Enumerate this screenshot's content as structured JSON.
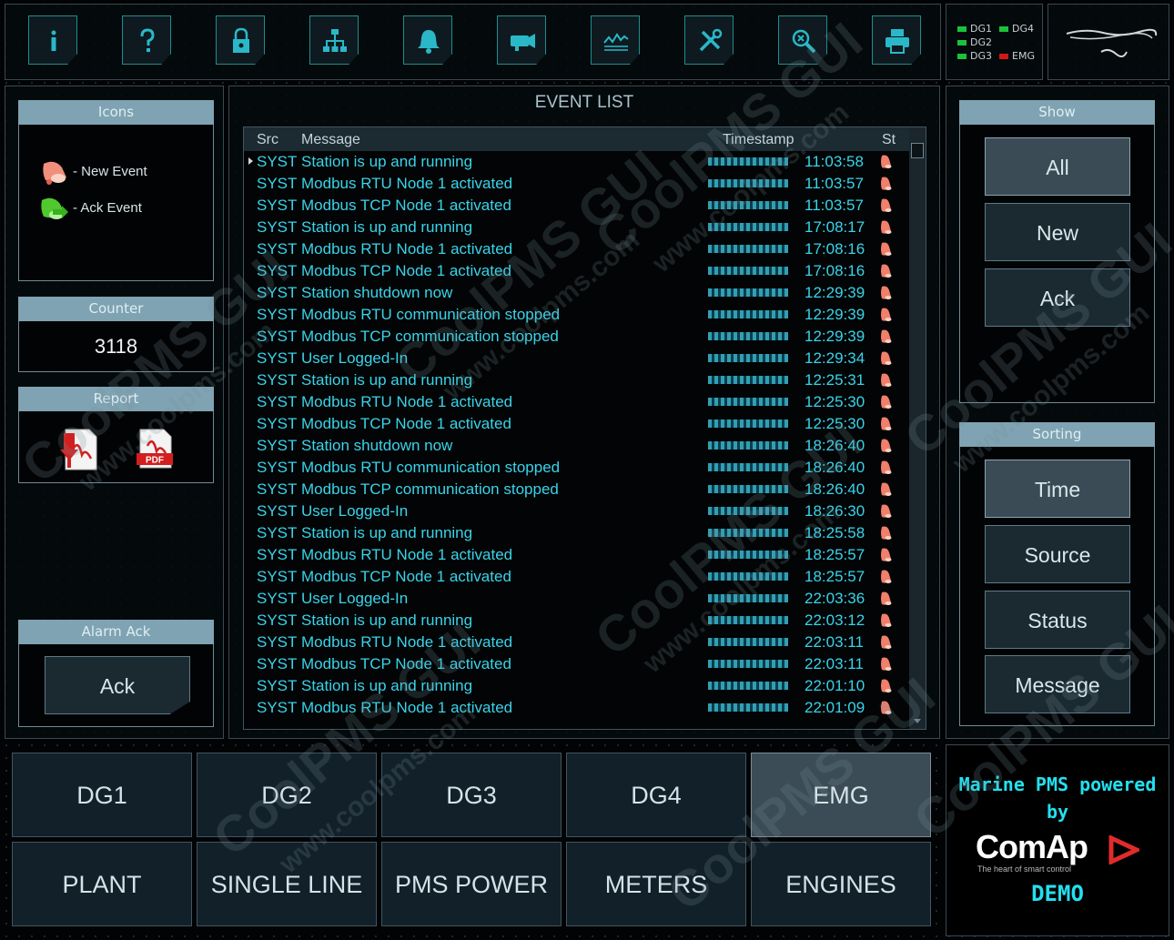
{
  "toolbar": {
    "icons": [
      "info-icon",
      "help-icon",
      "lock-icon",
      "network-icon",
      "bell-icon",
      "horn-icon",
      "trend-icon",
      "tools-icon",
      "search-icon",
      "printer-icon"
    ]
  },
  "indicators": [
    {
      "label": "DG1",
      "color": "#19c33a"
    },
    {
      "label": "DG4",
      "color": "#19c33a"
    },
    {
      "label": "DG2",
      "color": "#19c33a"
    },
    {
      "label": "DG3",
      "color": "#19c33a"
    },
    {
      "label": "EMG",
      "color": "#d01818"
    }
  ],
  "icons_panel": {
    "title": "Icons",
    "new_event": "- New Event",
    "ack_event": "- Ack Event"
  },
  "counter": {
    "title": "Counter",
    "value": "3118"
  },
  "report": {
    "title": "Report"
  },
  "alarm_ack": {
    "title": "Alarm Ack",
    "button": "Ack"
  },
  "event_list": {
    "title": "EVENT LIST",
    "columns": {
      "src": "Src",
      "message": "Message",
      "timestamp": "Timestamp",
      "status": "St"
    },
    "rows": [
      {
        "src": "SYST",
        "message": "Station is up and running",
        "time": "11:03:58"
      },
      {
        "src": "SYST",
        "message": "Modbus RTU Node 1 activated",
        "time": "11:03:57"
      },
      {
        "src": "SYST",
        "message": "Modbus TCP Node 1 activated",
        "time": "11:03:57"
      },
      {
        "src": "SYST",
        "message": "Station is up and running",
        "time": "17:08:17"
      },
      {
        "src": "SYST",
        "message": "Modbus RTU Node 1 activated",
        "time": "17:08:16"
      },
      {
        "src": "SYST",
        "message": "Modbus TCP Node 1 activated",
        "time": "17:08:16"
      },
      {
        "src": "SYST",
        "message": "Station shutdown now",
        "time": "12:29:39"
      },
      {
        "src": "SYST",
        "message": "Modbus RTU communication stopped",
        "time": "12:29:39"
      },
      {
        "src": "SYST",
        "message": "Modbus TCP communication stopped",
        "time": "12:29:39"
      },
      {
        "src": "SYST",
        "message": "User Logged-In",
        "time": "12:29:34"
      },
      {
        "src": "SYST",
        "message": "Station is up and running",
        "time": "12:25:31"
      },
      {
        "src": "SYST",
        "message": "Modbus RTU Node 1 activated",
        "time": "12:25:30"
      },
      {
        "src": "SYST",
        "message": "Modbus TCP Node 1 activated",
        "time": "12:25:30"
      },
      {
        "src": "SYST",
        "message": "Station shutdown now",
        "time": "18:26:40"
      },
      {
        "src": "SYST",
        "message": "Modbus RTU communication stopped",
        "time": "18:26:40"
      },
      {
        "src": "SYST",
        "message": "Modbus TCP communication stopped",
        "time": "18:26:40"
      },
      {
        "src": "SYST",
        "message": "User Logged-In",
        "time": "18:26:30"
      },
      {
        "src": "SYST",
        "message": "Station is up and running",
        "time": "18:25:58"
      },
      {
        "src": "SYST",
        "message": "Modbus RTU Node 1 activated",
        "time": "18:25:57"
      },
      {
        "src": "SYST",
        "message": "Modbus TCP Node 1 activated",
        "time": "18:25:57"
      },
      {
        "src": "SYST",
        "message": "User Logged-In",
        "time": "22:03:36"
      },
      {
        "src": "SYST",
        "message": "Station is up and running",
        "time": "22:03:12"
      },
      {
        "src": "SYST",
        "message": "Modbus RTU Node 1 activated",
        "time": "22:03:11"
      },
      {
        "src": "SYST",
        "message": "Modbus TCP Node 1 activated",
        "time": "22:03:11"
      },
      {
        "src": "SYST",
        "message": "Station is up and running",
        "time": "22:01:10"
      },
      {
        "src": "SYST",
        "message": "Modbus RTU Node 1 activated",
        "time": "22:01:09"
      }
    ]
  },
  "show": {
    "title": "Show",
    "buttons": [
      "All",
      "New",
      "Ack"
    ],
    "active": "All"
  },
  "sorting": {
    "title": "Sorting",
    "buttons": [
      "Time",
      "Source",
      "Status",
      "Message"
    ],
    "active": "Time"
  },
  "nav": {
    "row1": [
      "DG1",
      "DG2",
      "DG3",
      "DG4",
      "EMG"
    ],
    "row2": [
      "PLANT",
      "SINGLE LINE",
      "PMS POWER",
      "METERS",
      "ENGINES"
    ],
    "active": "EMG"
  },
  "brand": {
    "line1": "Marine PMS powered",
    "line2": "by",
    "logo": "ComAp",
    "tagline": "The heart of smart control",
    "demo": "DEMO"
  },
  "watermark": {
    "text1": "CoolPMS GUI",
    "text2": "www.coolpms.com"
  }
}
